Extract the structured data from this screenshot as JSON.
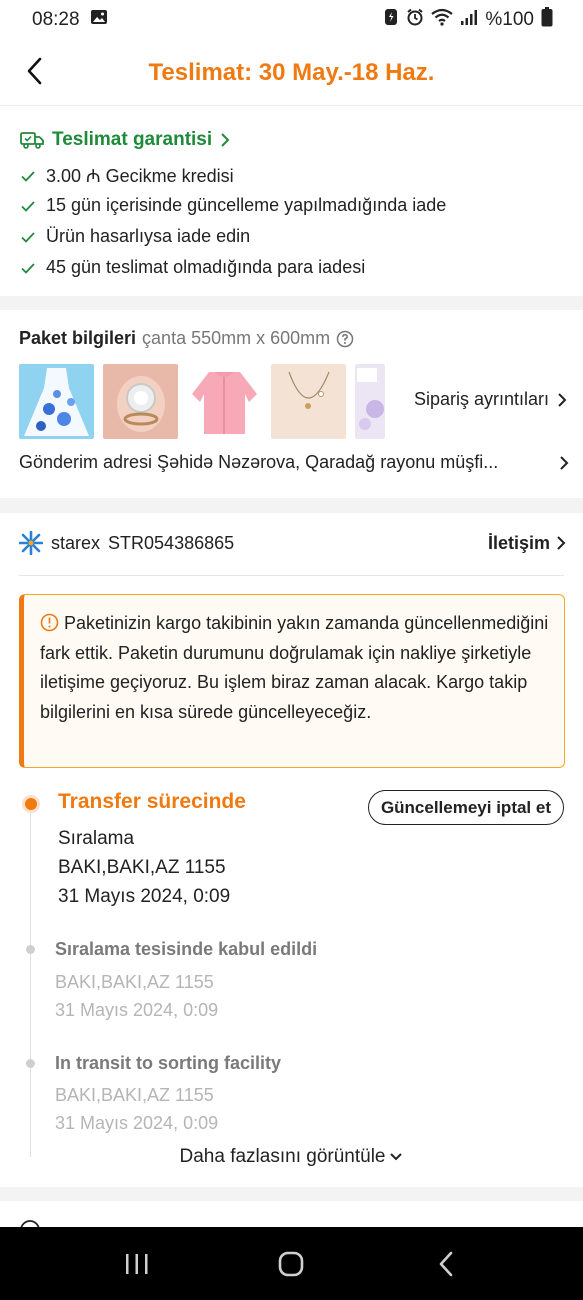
{
  "status_bar": {
    "time": "08:28",
    "battery": "%100"
  },
  "header": {
    "title": "Teslimat: 30 May.-18 Haz."
  },
  "guarantee": {
    "title": "Teslimat garantisi",
    "items": [
      "3.00 ₼ Gecikme kredisi",
      "15 gün içerisinde güncelleme yapılmadığında iade",
      "Ürün hasarlıysa iade edin",
      "45 gün teslimat olmadığında para iadesi"
    ]
  },
  "package": {
    "title": "Paket bilgileri",
    "size": "çanta 550mm x 600mm",
    "order_details": "Sipariş ayrıntıları",
    "address": "Gönderim adresi Şəhidə Nəzərova, Qaradağ rayonu müşfi..."
  },
  "carrier": {
    "name": "starex",
    "tracking": "STR054386865",
    "contact": "İletişim"
  },
  "notice": {
    "text": "Paketinizin kargo takibinin yakın zamanda güncellenmediğini fark ettik. Paketin durumunu doğrulamak için nakliye şirketiyle iletişime geçiyoruz. Bu işlem biraz zaman alacak. Kargo takip bilgilerini en kısa sürede güncelleyeceğiz."
  },
  "timeline": {
    "current": {
      "title": "Transfer sürecinde",
      "cancel_button": "Güncellemeyi iptal et",
      "lines": [
        "Sıralama",
        "BAKI,BAKI,AZ 1155",
        "31 Mayıs 2024, 0:09"
      ]
    },
    "events": [
      {
        "title": "Sıralama tesisinde kabul edildi",
        "location": "BAKI,BAKI,AZ 1155",
        "time": "31 Mayıs 2024, 0:09"
      },
      {
        "title": "In transit to sorting facility",
        "location": "BAKI,BAKI,AZ 1155",
        "time": "31 Mayıs 2024, 0:09"
      }
    ],
    "view_more": "Daha fazlasını görüntüle"
  },
  "colors": {
    "accent": "#f07a12",
    "guarantee_green": "#1f8a3a",
    "notice_border": "#f5a623"
  }
}
